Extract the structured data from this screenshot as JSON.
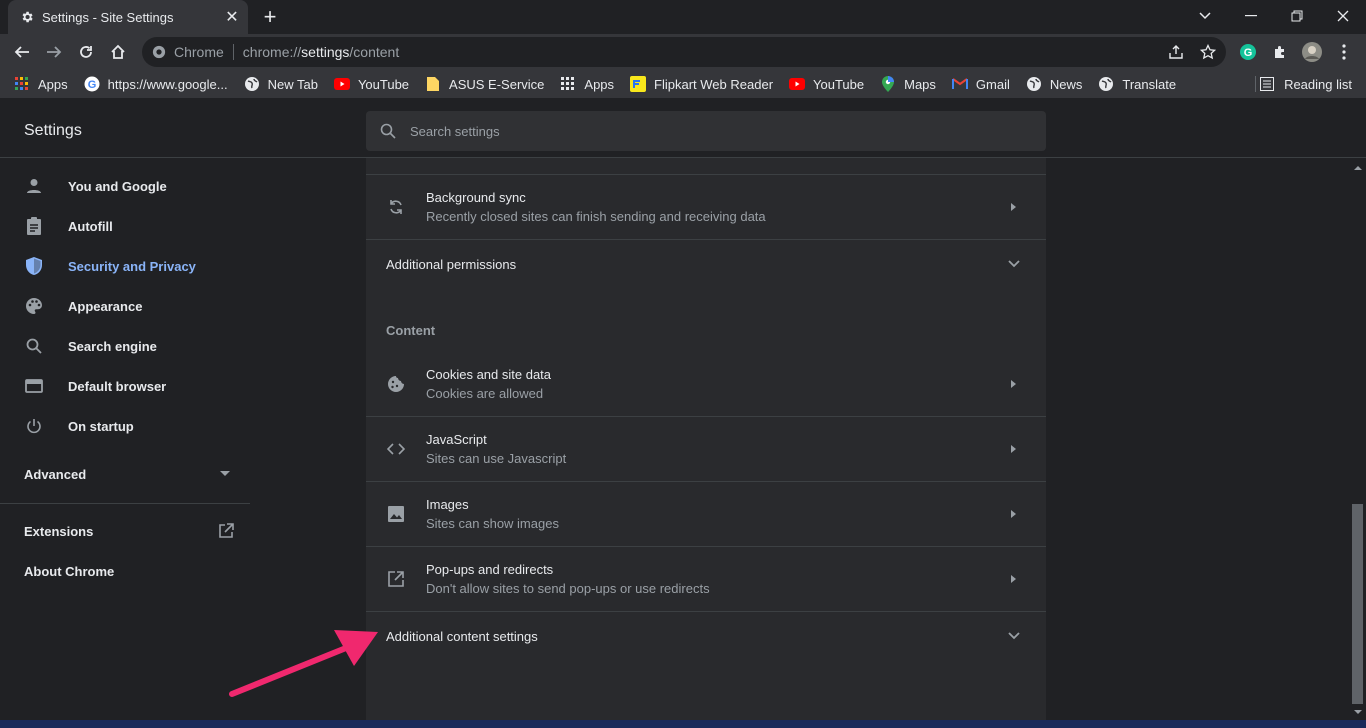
{
  "window": {
    "tab_title": "Settings - Site Settings",
    "controls": [
      "minimize",
      "restore",
      "close"
    ]
  },
  "toolbar": {
    "omnibox_scheme": "Chrome",
    "url_prefix": "chrome://",
    "url_host": "settings",
    "url_path": "/content"
  },
  "bookmarks": {
    "items": [
      {
        "label": "Apps",
        "icon": "apps-grid-icon"
      },
      {
        "label": "https://www.google...",
        "icon": "google-icon"
      },
      {
        "label": "New Tab",
        "icon": "globe-icon"
      },
      {
        "label": "YouTube",
        "icon": "youtube-icon"
      },
      {
        "label": "ASUS E-Service",
        "icon": "folder-icon"
      },
      {
        "label": "Apps",
        "icon": "apps-grid-icon"
      },
      {
        "label": "Flipkart Web Reader",
        "icon": "flipkart-icon"
      },
      {
        "label": "YouTube",
        "icon": "youtube-icon"
      },
      {
        "label": "Maps",
        "icon": "maps-icon"
      },
      {
        "label": "Gmail",
        "icon": "gmail-icon"
      },
      {
        "label": "News",
        "icon": "globe-icon"
      },
      {
        "label": "Translate",
        "icon": "globe-icon"
      }
    ],
    "reading_list": "Reading list"
  },
  "settings": {
    "title": "Settings",
    "search_placeholder": "Search settings"
  },
  "sidebar": {
    "items": [
      {
        "label": "You and Google",
        "icon": "person-icon"
      },
      {
        "label": "Autofill",
        "icon": "clipboard-icon"
      },
      {
        "label": "Security and Privacy",
        "icon": "shield-icon",
        "active": true
      },
      {
        "label": "Appearance",
        "icon": "palette-icon"
      },
      {
        "label": "Search engine",
        "icon": "search-icon"
      },
      {
        "label": "Default browser",
        "icon": "browser-icon"
      },
      {
        "label": "On startup",
        "icon": "power-icon"
      }
    ],
    "advanced": "Advanced",
    "extensions": "Extensions",
    "about": "About Chrome"
  },
  "content": {
    "background_sync": {
      "title": "Background sync",
      "subtitle": "Recently closed sites can finish sending and receiving data"
    },
    "additional_permissions": "Additional permissions",
    "section_label": "Content",
    "rows": [
      {
        "title": "Cookies and site data",
        "subtitle": "Cookies are allowed",
        "icon": "cookie-icon"
      },
      {
        "title": "JavaScript",
        "subtitle": "Sites can use Javascript",
        "icon": "code-icon"
      },
      {
        "title": "Images",
        "subtitle": "Sites can show images",
        "icon": "image-icon"
      },
      {
        "title": "Pop-ups and redirects",
        "subtitle": "Don't allow sites to send pop-ups or use redirects",
        "icon": "open-in-new-icon"
      }
    ],
    "additional_content": "Additional content settings"
  },
  "colors": {
    "accent": "#8ab4f8",
    "annotation_arrow": "#f0286e"
  }
}
